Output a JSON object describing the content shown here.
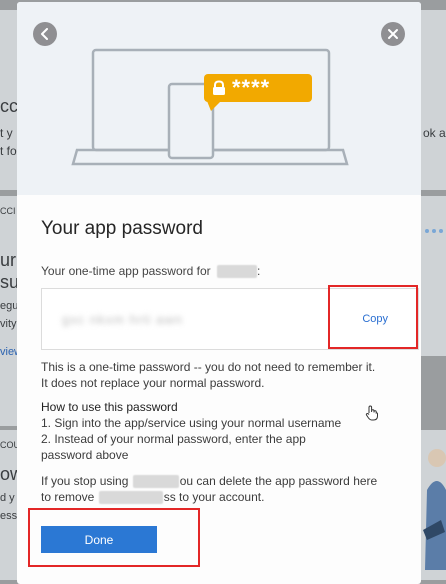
{
  "dialog": {
    "title": "Your app password",
    "label": "Your one-time app password for",
    "label_suffix": ":",
    "password_masked": "gxc nkxm hrti awn",
    "copy_label": "Copy",
    "note_line1": "This is a one-time password -- you do not need to remember it.",
    "note_line2": "It does not replace your normal password.",
    "howto_heading": "How to use this password",
    "step1": "1. Sign into the app/service using your normal username",
    "step2a": "2. Instead of your normal password, enter the app",
    "step2b": "password above",
    "stop_part1": "If you stop using",
    "stop_part2": "ou can delete the app password here",
    "stop_part3": "to remove",
    "stop_part4": "ss to your account.",
    "done_label": "Done",
    "lock_stars": "****"
  },
  "background": {
    "left_fragments": [
      "cc",
      "t y",
      "t fo",
      "CCI",
      "ur",
      "sue",
      "egula",
      "vity",
      "view",
      "COU",
      "ow",
      "d y",
      "ess"
    ],
    "right_fragments": [
      "ok a"
    ]
  },
  "colors": {
    "accent": "#2b78d4",
    "highlight": "#e32727",
    "lock_badge": "#f2a900"
  },
  "icons": {
    "back": "chevron-left-icon",
    "close": "close-icon",
    "lock": "lock-icon",
    "cursor": "hand-cursor-icon"
  }
}
